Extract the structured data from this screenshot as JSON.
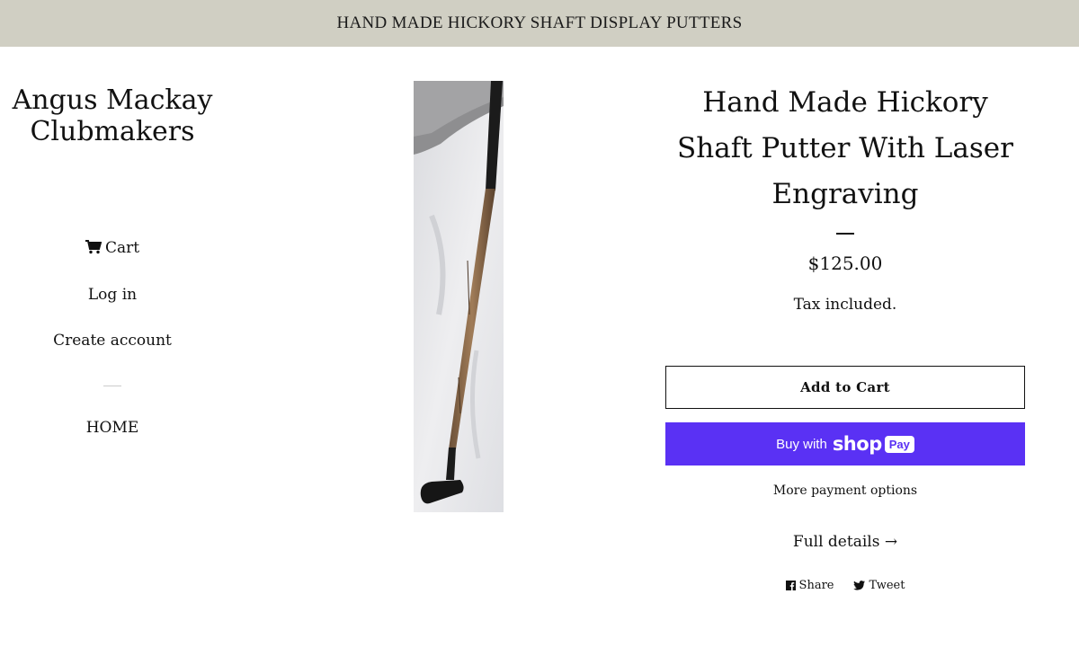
{
  "announcement": {
    "text": "HAND MADE HICKORY SHAFT DISPLAY PUTTERS"
  },
  "site": {
    "title": "Angus Mackay Clubmakers"
  },
  "nav": {
    "cart_label": "Cart",
    "login_label": "Log in",
    "create_account_label": "Create account",
    "home_label": "HOME"
  },
  "product": {
    "title": "Hand Made Hickory Shaft Putter With Laser Engraving",
    "price": "$125.00",
    "tax_note": "Tax included.",
    "add_to_cart_label": "Add to Cart",
    "shop_pay": {
      "buy_with": "Buy with",
      "shop": "shop",
      "pay": "Pay"
    },
    "more_payment_label": "More payment options",
    "full_details_label": "Full details →",
    "share_label": "Share",
    "tweet_label": "Tweet"
  },
  "icons": {
    "cart": "cart-icon",
    "facebook": "facebook-icon",
    "twitter": "twitter-icon"
  },
  "colors": {
    "announcement_bg": "#d0cfc3",
    "shop_pay_purple": "#5a31f4"
  }
}
